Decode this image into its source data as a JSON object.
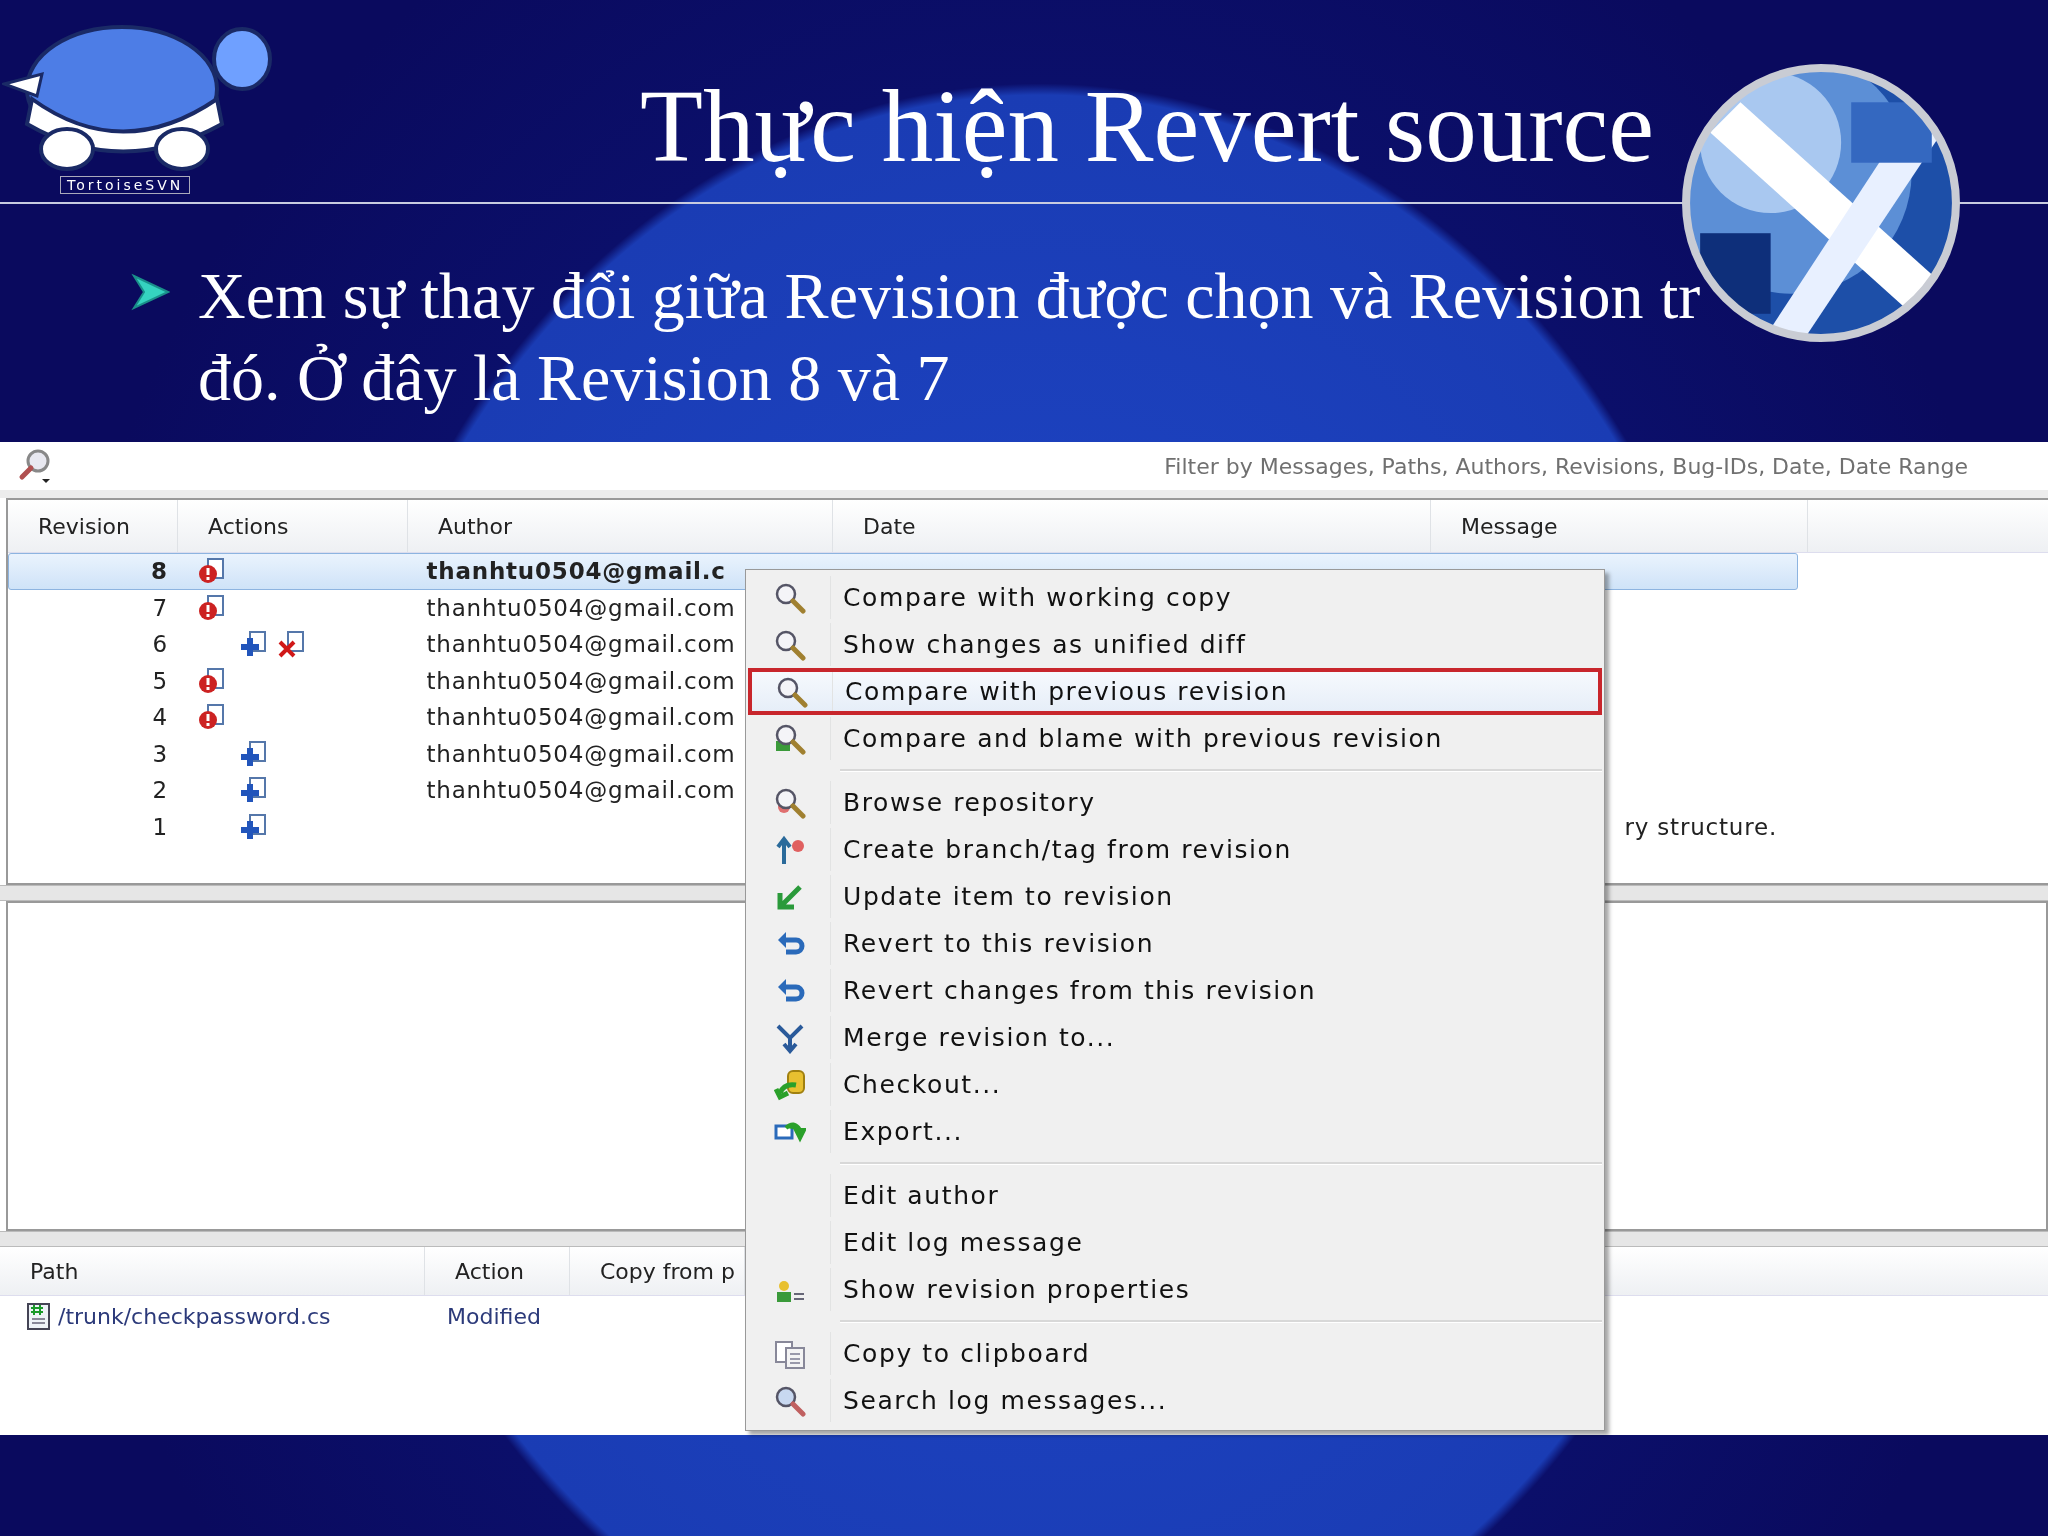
{
  "slide": {
    "title": "Thực hiện Revert source",
    "logo_text": "TortoiseSVN",
    "bullet_lines": [
      "Xem sự thay đổi giữa Revision được chọn và Revision tr",
      "đó. Ở đây là Revision 8 và 7"
    ]
  },
  "log_window": {
    "filter_placeholder": "Filter by Messages, Paths, Authors, Revisions, Bug-IDs, Date, Date Range",
    "columns": [
      "Revision",
      "Actions",
      "Author",
      "Date",
      "Message"
    ],
    "rows": [
      {
        "revision": "8",
        "actions": [
          {
            "kind": "modified"
          }
        ],
        "author": "thanhtu0504@gmail.c",
        "selected": true
      },
      {
        "revision": "7",
        "actions": [
          {
            "kind": "modified"
          }
        ],
        "author": "thanhtu0504@gmail.com",
        "selected": false
      },
      {
        "revision": "6",
        "actions": [
          {
            "kind": "added"
          },
          {
            "kind": "deleted"
          }
        ],
        "author": "thanhtu0504@gmail.com",
        "selected": false
      },
      {
        "revision": "5",
        "actions": [
          {
            "kind": "modified"
          }
        ],
        "author": "thanhtu0504@gmail.com",
        "selected": false
      },
      {
        "revision": "4",
        "actions": [
          {
            "kind": "modified"
          }
        ],
        "author": "thanhtu0504@gmail.com",
        "selected": false
      },
      {
        "revision": "3",
        "actions": [
          {
            "kind": "added"
          }
        ],
        "author": "thanhtu0504@gmail.com",
        "selected": false
      },
      {
        "revision": "2",
        "actions": [
          {
            "kind": "added"
          }
        ],
        "author": "thanhtu0504@gmail.com",
        "selected": false
      },
      {
        "revision": "1",
        "actions": [
          {
            "kind": "added"
          }
        ],
        "message": "ry structure.",
        "selected": false
      }
    ],
    "changed_paths": {
      "columns": [
        "Path",
        "Action",
        "Copy from p"
      ],
      "rows": [
        {
          "path": "/trunk/checkpassword.cs",
          "action": "Modified"
        }
      ]
    }
  },
  "context_menu": {
    "groups": [
      [
        {
          "label": "Compare with working copy",
          "selected": false
        },
        {
          "label": "Show changes as unified diff",
          "selected": false
        },
        {
          "label": "Compare with previous revision",
          "selected": true
        },
        {
          "label": "Compare and blame with previous revision",
          "selected": false
        }
      ],
      [
        {
          "label": "Browse repository",
          "selected": false
        },
        {
          "label": "Create branch/tag from revision",
          "selected": false
        },
        {
          "label": "Update item to revision",
          "selected": false
        },
        {
          "label": "Revert to this revision",
          "selected": false
        },
        {
          "label": "Revert changes from this revision",
          "selected": false
        },
        {
          "label": "Merge revision to...",
          "selected": false
        },
        {
          "label": "Checkout...",
          "selected": false
        },
        {
          "label": "Export...",
          "selected": false
        }
      ],
      [
        {
          "label": "Edit author",
          "selected": false
        },
        {
          "label": "Edit log message",
          "selected": false
        },
        {
          "label": "Show revision properties",
          "selected": false
        }
      ],
      [
        {
          "label": "Copy to clipboard",
          "selected": false
        },
        {
          "label": "Search log messages...",
          "selected": false
        }
      ]
    ]
  }
}
